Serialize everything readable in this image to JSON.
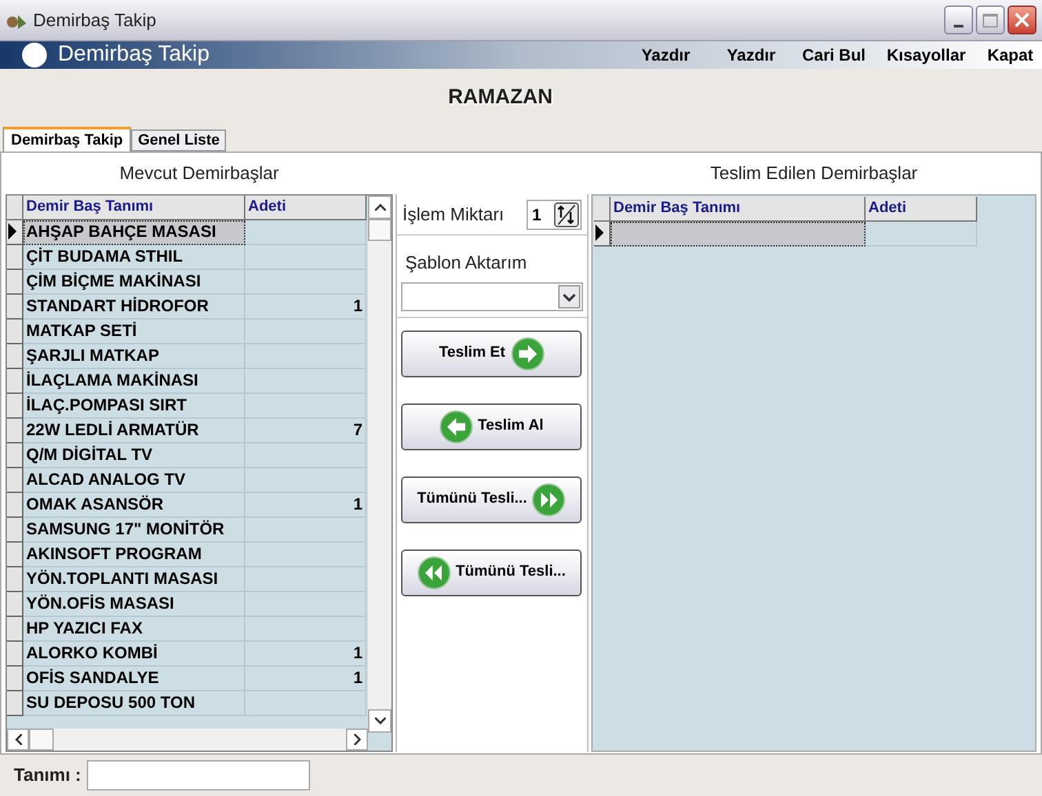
{
  "window": {
    "title": "Demirbaş Takip"
  },
  "header": {
    "title": "Demirbaş Takip",
    "menu": [
      "Yazdır",
      "Yazdır",
      "Cari Bul",
      "Kısayollar",
      "Kapat"
    ]
  },
  "user": "RAMAZAN",
  "tabs": [
    {
      "label": "Demirbaş Takip",
      "selected": true
    },
    {
      "label": "Genel Liste",
      "selected": false
    }
  ],
  "left": {
    "heading": "Mevcut Demirbaşlar",
    "columns": [
      "Demir Baş Tanımı",
      "Adeti"
    ],
    "rows": [
      {
        "name": "AHŞAP BAHÇE MASASI",
        "count": "",
        "selected": true
      },
      {
        "name": "ÇİT BUDAMA STHIL",
        "count": "",
        "selected": false
      },
      {
        "name": "ÇİM BİÇME MAKİNASI",
        "count": "",
        "selected": false
      },
      {
        "name": "STANDART HİDROFOR",
        "count": "1",
        "selected": false
      },
      {
        "name": "MATKAP SETİ",
        "count": "",
        "selected": false
      },
      {
        "name": "ŞARJLI MATKAP",
        "count": "",
        "selected": false
      },
      {
        "name": "İLAÇLAMA MAKİNASI",
        "count": "",
        "selected": false
      },
      {
        "name": "İLAÇ.POMPASI SIRT",
        "count": "",
        "selected": false
      },
      {
        "name": "22W LEDLİ ARMATÜR",
        "count": "7",
        "selected": false
      },
      {
        "name": "Q/M DİGİTAL TV",
        "count": "",
        "selected": false
      },
      {
        "name": "ALCAD ANALOG TV",
        "count": "",
        "selected": false
      },
      {
        "name": "OMAK ASANSÖR",
        "count": "1",
        "selected": false
      },
      {
        "name": "SAMSUNG 17\" MONİTÖR",
        "count": "",
        "selected": false
      },
      {
        "name": "AKINSOFT PROGRAM",
        "count": "",
        "selected": false
      },
      {
        "name": "YÖN.TOPLANTI MASASI",
        "count": "",
        "selected": false
      },
      {
        "name": "YÖN.OFİS MASASI",
        "count": "",
        "selected": false
      },
      {
        "name": "HP YAZICI FAX",
        "count": "",
        "selected": false
      },
      {
        "name": "ALORKO KOMBİ",
        "count": "1",
        "selected": false
      },
      {
        "name": "OFİS SANDALYE",
        "count": "1",
        "selected": false
      },
      {
        "name": "SU DEPOSU 500 TON",
        "count": "",
        "selected": false
      }
    ]
  },
  "middle": {
    "quantity_label": "İşlem Miktarı",
    "quantity": "1",
    "template_label": "Şablon Aktarım",
    "buttons": [
      "Teslim Et",
      "Teslim Al",
      "Tümünü Tesli...",
      "Tümünü Tesli..."
    ]
  },
  "right": {
    "heading": "Teslim Edilen Demirbaşlar",
    "columns": [
      "Demir Baş Tanımı",
      "Adeti"
    ],
    "rows": [
      {
        "name": "",
        "count": "",
        "selected": true
      }
    ]
  },
  "footer": {
    "label": "Tanımı :"
  }
}
